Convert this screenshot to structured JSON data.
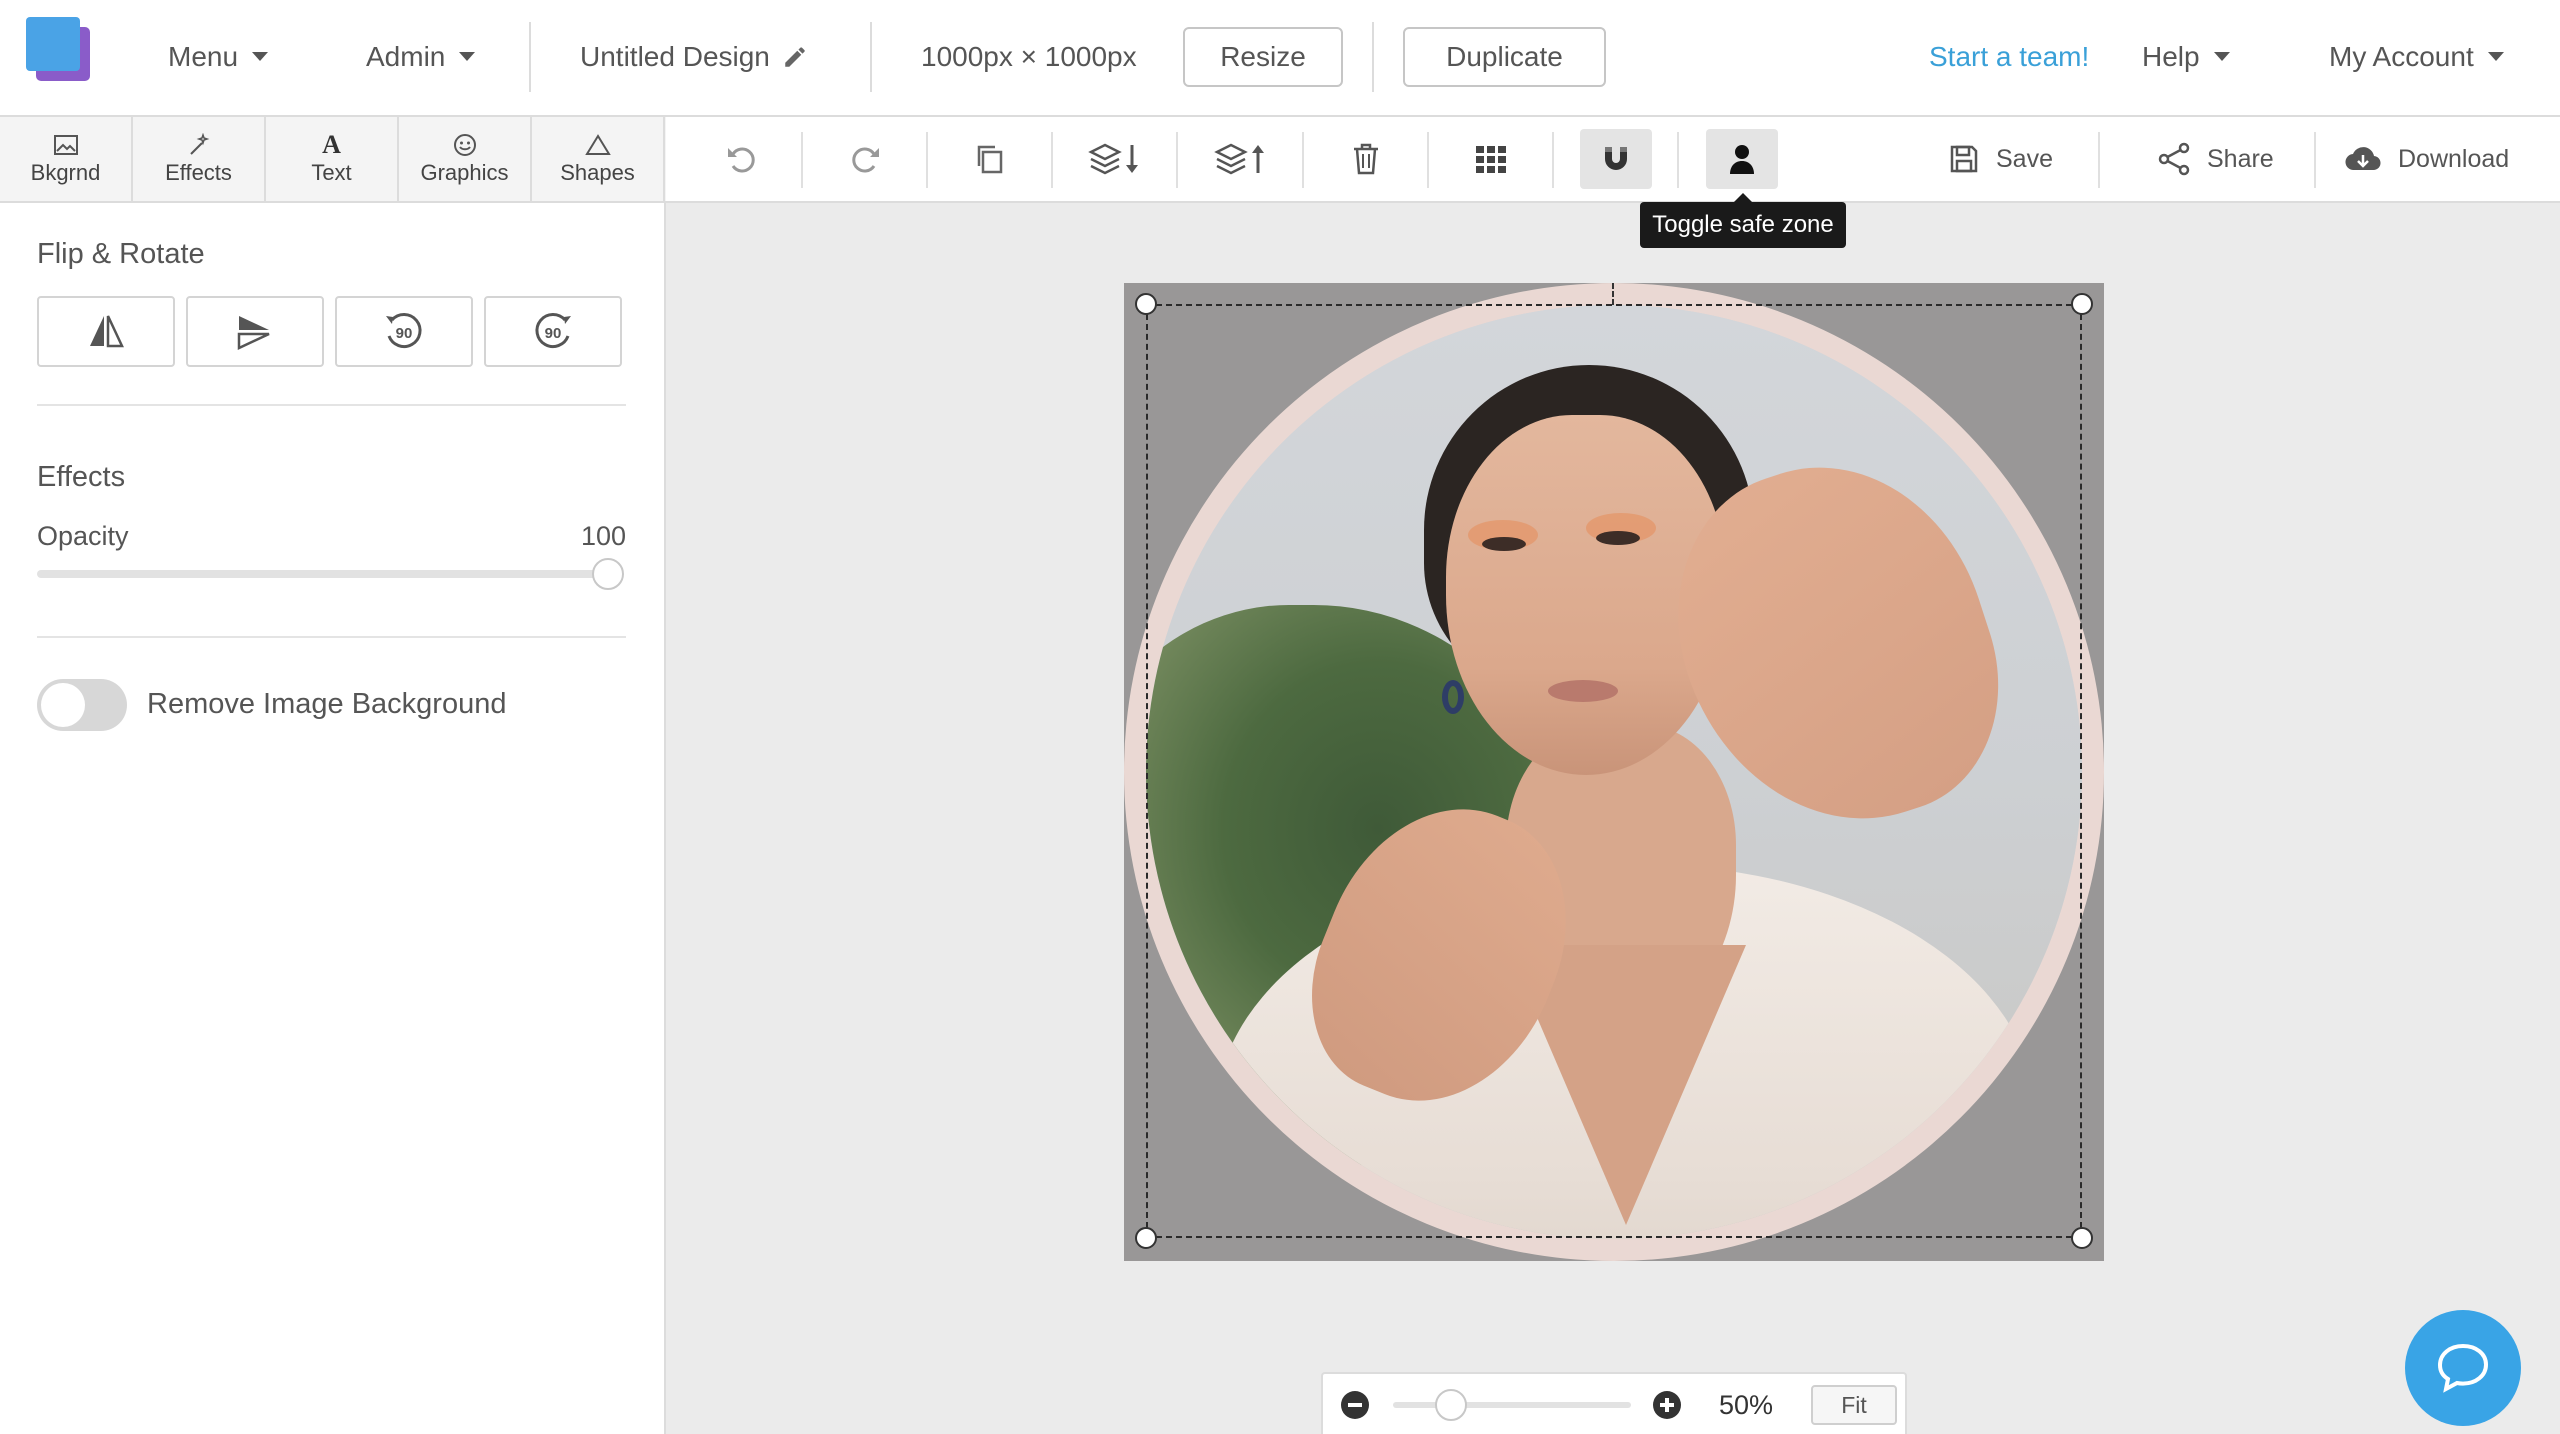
{
  "header": {
    "menu_label": "Menu",
    "admin_label": "Admin",
    "design_title": "Untitled Design",
    "dimensions": "1000px × 1000px",
    "resize_label": "Resize",
    "duplicate_label": "Duplicate",
    "start_team_label": "Start a team!",
    "help_label": "Help",
    "account_label": "My Account",
    "accent_color": "#3aa0d8"
  },
  "tabs": [
    {
      "label": "Bkgrnd",
      "icon": "image-icon"
    },
    {
      "label": "Effects",
      "icon": "magic-wand-icon"
    },
    {
      "label": "Text",
      "icon": "text-icon"
    },
    {
      "label": "Graphics",
      "icon": "smiley-icon"
    },
    {
      "label": "Shapes",
      "icon": "triangle-icon"
    }
  ],
  "panel": {
    "flip_heading": "Flip & Rotate",
    "flip_buttons": [
      {
        "icon": "flip-horizontal-icon"
      },
      {
        "icon": "flip-vertical-icon"
      },
      {
        "icon": "rotate-left-90-icon",
        "text": "90"
      },
      {
        "icon": "rotate-right-90-icon",
        "text": "90"
      }
    ],
    "effects_heading": "Effects",
    "opacity_label": "Opacity",
    "opacity_value": "100",
    "opacity_fraction": 1.0,
    "remove_bg_label": "Remove Image Background",
    "remove_bg_enabled": false
  },
  "toolbar": {
    "save_label": "Save",
    "share_label": "Share",
    "download_label": "Download",
    "tooltip": "Toggle safe zone"
  },
  "zoom": {
    "value": "50%",
    "fit_label": "Fit"
  }
}
